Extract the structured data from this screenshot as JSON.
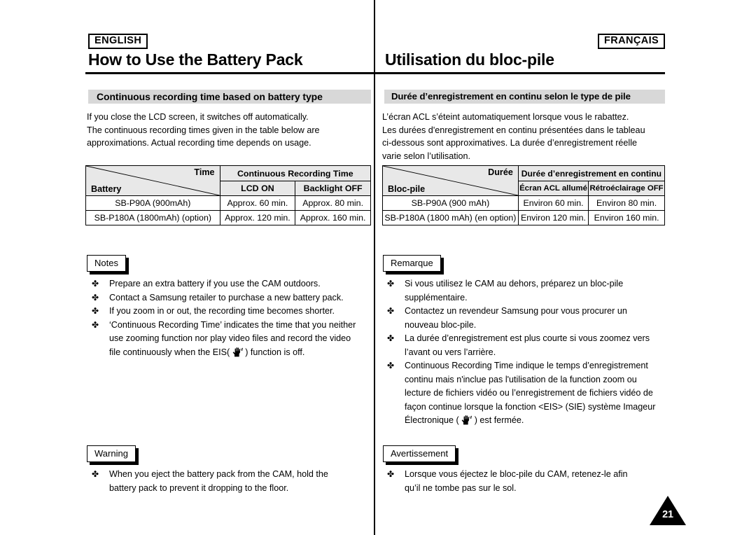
{
  "page": {
    "number": "21",
    "divider": "vertical-rule",
    "bullet_glyph": "✤",
    "eis_icon_name": "hand-stabilizer-icon"
  },
  "english": {
    "language_tag": "ENGLISH",
    "chapter_title": "How to Use the Battery Pack",
    "section_band": "Continuous recording time based on battery type",
    "intro_lines": [
      "If you close the LCD screen, it switches off automatically.",
      "The continuous recording times given in the table below are",
      "approximations. Actual recording time depends on usage."
    ],
    "table": {
      "corner_top_label": "Time",
      "corner_bottom_label": "Battery",
      "group_header": "Continuous Recording Time",
      "sub_headers": [
        "LCD ON",
        "Backlight OFF"
      ],
      "rows": [
        {
          "battery": "SB-P90A (900mAh)",
          "lcd_on": "Approx. 60 min.",
          "backlight_off": "Approx. 80 min."
        },
        {
          "battery": "SB-P180A (1800mAh) (option)",
          "lcd_on": "Approx. 120 min.",
          "backlight_off": "Approx. 160 min."
        }
      ]
    },
    "notes_label": "Notes",
    "notes": [
      {
        "lines": [
          "Prepare an extra battery if you use the CAM outdoors."
        ]
      },
      {
        "lines": [
          "Contact a Samsung retailer to purchase a new battery pack."
        ]
      },
      {
        "lines": [
          "If you zoom in or out, the recording time becomes shorter."
        ]
      },
      {
        "lines": [
          "‘Continuous Recording Time’ indicates the time that you neither",
          "use zooming function nor play video files and record the video"
        ],
        "last_line_before_icon": "file continuously when the EIS( ",
        "last_line_after_icon": " ) function is off."
      }
    ],
    "warning_label": "Warning",
    "warnings": [
      {
        "lines": [
          "When you eject the battery pack from the CAM, hold the",
          "battery pack to prevent it dropping to the floor."
        ]
      }
    ]
  },
  "french": {
    "language_tag": "FRANÇAIS",
    "chapter_title": "Utilisation du bloc-pile",
    "section_band": "Durée d’enregistrement en continu selon le type de pile",
    "intro_lines": [
      "L’écran ACL s’éteint automatiquement lorsque vous le rabattez.",
      "Les durées d'enregistrement en continu présentées dans le tableau",
      "ci-dessous sont approximatives. La durée d’enregistrement réelle",
      "varie selon l’utilisation."
    ],
    "table": {
      "corner_top_label": "Durée",
      "corner_bottom_label": "Bloc-pile",
      "group_header": "Durée d’enregistrement en continu",
      "sub_headers": [
        "Écran ACL allumé",
        "Rétroéclairage OFF"
      ],
      "rows": [
        {
          "battery": "SB-P90A (900 mAh)",
          "lcd_on": "Environ 60 min.",
          "backlight_off": "Environ 80 min."
        },
        {
          "battery": "SB-P180A (1800 mAh) (en option)",
          "lcd_on": "Environ 120 min.",
          "backlight_off": "Environ 160 min."
        }
      ]
    },
    "notes_label": "Remarque",
    "notes": [
      {
        "lines": [
          "Si vous utilisez le CAM au dehors, préparez un bloc-pile",
          "supplémentaire."
        ]
      },
      {
        "lines": [
          "Contactez un revendeur Samsung pour vous procurer un",
          "nouveau bloc-pile."
        ]
      },
      {
        "lines": [
          "La durée d’enregistrement est plus courte si vous zoomez vers",
          "l’avant ou vers l’arrière."
        ]
      },
      {
        "lines": [
          "Continuous Recording Time indique le temps d’enregistrement",
          "continu mais n'inclue pas l'utilisation de la function zoom ou",
          "lecture de fichiers vidéo ou l’enregistrement de fichiers vidéo de",
          "façon continue lorsque la fonction <EIS> (SIE) système Imageur"
        ],
        "last_line_before_icon": "Électronique ( ",
        "last_line_after_icon": " ) est fermée."
      }
    ],
    "warning_label": "Avertissement",
    "warnings": [
      {
        "lines": [
          "Lorsque vous éjectez le bloc-pile du CAM, retenez-le afin",
          "qu’il ne tombe pas sur le sol."
        ]
      }
    ]
  }
}
